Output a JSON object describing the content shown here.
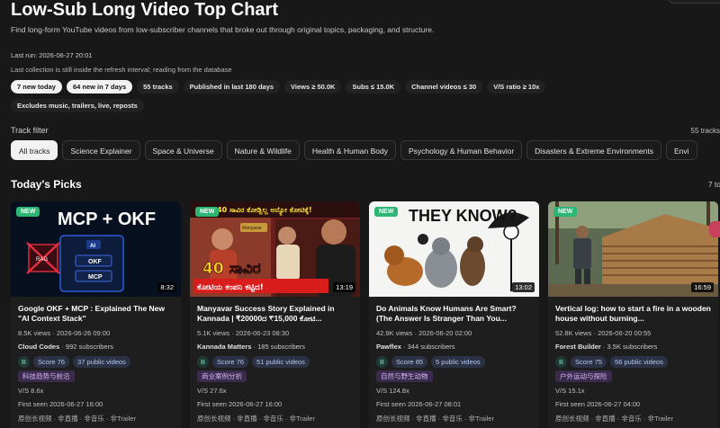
{
  "header": {
    "title": "Low-Sub Long Video Top Chart",
    "description": "Find long-form YouTube videos from low-subscriber channels that broke out through original topics, packaging, and structure.",
    "last_run": "Last run: 2026-06-27 20:01",
    "note": "Last collection is still inside the refresh interval; reading from the database"
  },
  "chips": [
    {
      "label": "7 new today",
      "style": "light"
    },
    {
      "label": "64 new in 7 days",
      "style": "light"
    },
    {
      "label": "55 tracks",
      "style": "dark"
    },
    {
      "label": "Published in last 180 days",
      "style": "dark"
    },
    {
      "label": "Views ≥ 50.0K",
      "style": "dark"
    },
    {
      "label": "Subs ≤ 15.0K",
      "style": "dark"
    },
    {
      "label": "Channel videos ≤ 30",
      "style": "dark"
    },
    {
      "label": "V/S ratio ≥ 10x",
      "style": "dark"
    },
    {
      "label": "Excludes music, trailers, live, reposts",
      "style": "dark"
    }
  ],
  "track_filter": {
    "label": "Track filter",
    "count": "55 tracks",
    "tabs": [
      "All tracks",
      "Science Explainer",
      "Space & Universe",
      "Nature & Wildlife",
      "Health & Human Body",
      "Psychology & Human Behavior",
      "Disasters & Extreme Environments",
      "Envi"
    ]
  },
  "picks": {
    "heading": "Today's Picks",
    "total": "7 total"
  },
  "cards": [
    {
      "badge": "NEW",
      "duration": "8:32",
      "title": "Google OKF + MCP : Explained The New \"AI Context Stack\"",
      "views": "8.5K views · 2026-06-26 09:00",
      "channel": "Cloud Codes",
      "subs": "· 992 subscribers",
      "grade": "B",
      "score": "Score 76",
      "videos": "37 public videos",
      "category": "科技趋势与前沿",
      "vs": "V/S 8.6x",
      "seen": "First seen 2026-06-27 16:00",
      "tags": "原创长视频 · 非直播 · 非音乐 · 非Trailer"
    },
    {
      "badge": "NEW",
      "duration": "13:19",
      "title": "Manyavar Success Story Explained in Kannada | ₹20000ದ ₹15,000 ಕೋಟಿ...",
      "views": "5.1K views · 2026-06-23 08:30",
      "channel": "Kannada Matters",
      "subs": "· 185 subscribers",
      "grade": "B",
      "score": "Score 76",
      "videos": "51 public videos",
      "category": "商业案例分析",
      "vs": "V/S 27.6x",
      "seen": "First seen 2026-06-27 16:00",
      "tags": "原创长视频 · 非直播 · 非音乐 · 非Trailer"
    },
    {
      "badge": "NEW",
      "duration": "13:02",
      "title": "Do Animals Know Humans Are Smart? (The Answer Is Stranger Than You...",
      "views": "42.9K views · 2026-06-20 02:00",
      "channel": "Pawflex",
      "subs": "· 344 subscribers",
      "grade": "B",
      "score": "Score 85",
      "videos": "5 public videos",
      "category": "自然与野生动物",
      "vs": "V/S 124.8x",
      "seen": "First seen 2026-06-27 08:01",
      "tags": "原创长视频 · 非直播 · 非音乐 · 非Trailer"
    },
    {
      "badge": "NEW",
      "duration": "16:59",
      "title": "Vertical log: how to start a fire in a wooden house without burning...",
      "views": "52.8K views · 2026-06-20 00:55",
      "channel": "Forest Builder",
      "subs": "· 3.5K subscribers",
      "grade": "B",
      "score": "Score 75",
      "videos": "56 public videos",
      "category": "户外运动与探险",
      "vs": "V/S 15.1x",
      "seen": "First seen 2026-06-27 04:00",
      "tags": "原创长视频 · 非直播 · 非音乐 · 非Trailer"
    }
  ],
  "thumb_text": {
    "t1_main": "MCP + OKF",
    "t1_ai": "AI",
    "t1_okf": "OKF",
    "t1_mcp": "MCP",
    "t1_rag": "RAG",
    "t2_main": "40 ಸಾವಿರ",
    "t2_sub": "ಕೋಟಿಯ ಕಂಪನಿ ಕಟ್ಟಿದ!",
    "t2_top": "40 ಸಾವಿರ ಕೋಡ್ಲಿಲ್ಲ ಅನ್ಯೋ ಕೋಟಿಕ್ಕೆ!",
    "t2_brand": "Manyavar",
    "t3_main": "THEY KNOW?"
  }
}
